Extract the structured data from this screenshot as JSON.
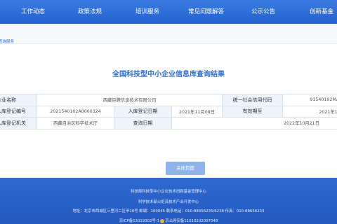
{
  "nav": {
    "items": [
      "工作动态",
      "政策法规",
      "培训服务",
      "常见问题解答",
      "公示公告",
      "创新基金"
    ]
  },
  "breadcrumb": "查询服务",
  "page_title": "全国科技型中小企业信息库查询结果",
  "table": {
    "company_name_label": "企业名称",
    "company_name_value": "西藏巨腾信息技术有限公司",
    "credit_code_label": "统一社会信用代码",
    "credit_code_value": "91540192MA6T",
    "reg_no_label": "入库登记编号",
    "reg_no_value": "2021540102A0000324",
    "reg_date_label": "入库登记日期",
    "reg_date_value": "2021年11月08日",
    "valid_label": "有效期至",
    "valid_value": "2021年12月",
    "authority_label": "入库登记机关",
    "authority_value": "西藏自治区科学技术厅",
    "query_date_label": "查询日期",
    "query_date_value": "2022年10月21日"
  },
  "close_button": "关闭页面",
  "footer": {
    "line1": "科技部科技型中小企业技术创新基金管理中心",
    "line2": "科学技术部火炬高技术产业开发中心",
    "line3": "地址：北京市西城区三里河二区甲18号 邮编：100045 联系电话：010-88656235/6238 传真：010-88656234",
    "icp_left": "京ICP备13019302号-1",
    "icp_right": "京公网安备11010202007048"
  },
  "colors": {
    "nav_bg": "#2b6bd6",
    "accent": "#2f6fd1",
    "label_bg": "#eef4fc",
    "button_bg": "#8fb4ea"
  }
}
